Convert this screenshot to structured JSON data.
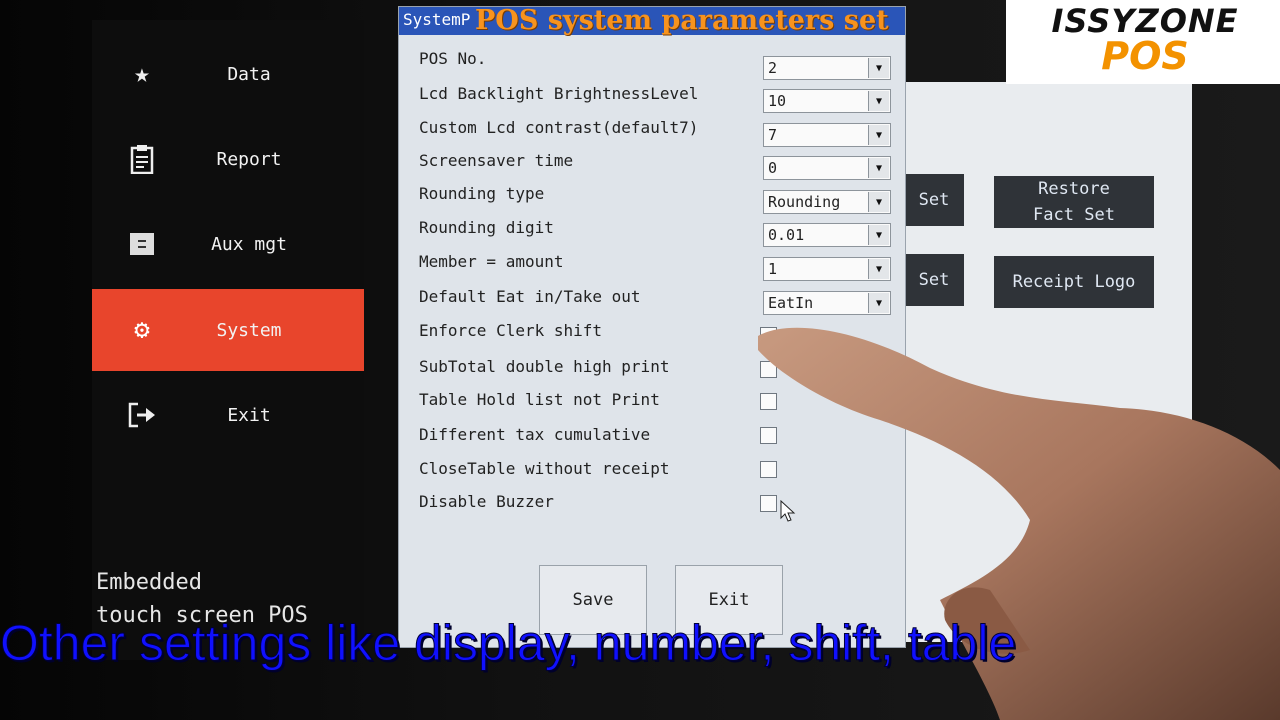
{
  "sidebar": {
    "items": [
      {
        "label": "Data",
        "icon": "star-icon"
      },
      {
        "label": "Report",
        "icon": "clipboard-icon"
      },
      {
        "label": "Aux mgt",
        "icon": "box-icon"
      },
      {
        "label": "System",
        "icon": "gear-icon",
        "active": true
      },
      {
        "label": "Exit",
        "icon": "exit-icon"
      }
    ],
    "accent": "#e8452c"
  },
  "caption_small": "Embedded\ntouch screen POS",
  "right_buttons": {
    "set1": "Set",
    "restore": "Restore\nFact Set",
    "set2": "Set",
    "receipt_logo": "Receipt Logo"
  },
  "dialog": {
    "title": "SystemP",
    "overlay_title": "POS system parameters set",
    "fields": [
      {
        "label": "POS  No.",
        "value": "2"
      },
      {
        "label": "Lcd Backlight BrightnessLevel",
        "value": "10"
      },
      {
        "label": "Custom Lcd contrast(default7)",
        "value": "7"
      },
      {
        "label": "Screensaver time",
        "value": "0"
      },
      {
        "label": "Rounding type",
        "value": "Rounding"
      },
      {
        "label": "Rounding digit",
        "value": "0.01"
      },
      {
        "label": "Member = amount",
        "value": "1"
      },
      {
        "label": "Default Eat in/Take out",
        "value": "EatIn"
      }
    ],
    "checks": [
      {
        "label": "Enforce Clerk shift"
      },
      {
        "label": "SubTotal double high print"
      },
      {
        "label": "Table Hold list not Print"
      },
      {
        "label": "Different tax cumulative"
      },
      {
        "label": "CloseTable without receipt"
      },
      {
        "label": "Disable Buzzer"
      }
    ],
    "save_label": "Save",
    "exit_label": "Exit"
  },
  "logo": {
    "line1": "ISSYZONE",
    "line2": "POS",
    "color": "#f39200"
  },
  "subtitle": "Other settings like display, number, shift, table"
}
